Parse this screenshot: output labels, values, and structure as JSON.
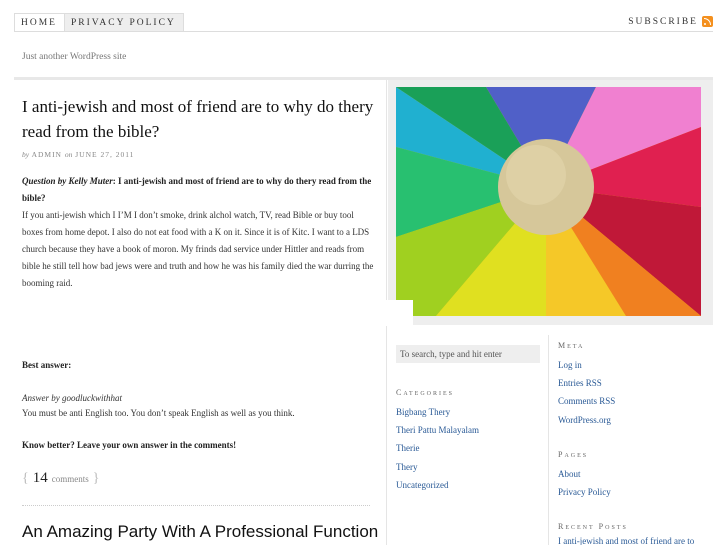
{
  "nav": {
    "tabs": [
      "HOME",
      "PRIVACY POLICY"
    ],
    "subscribe": "SUBSCRIBE"
  },
  "tagline": "Just another WordPress site",
  "post": {
    "title": "I anti-jewish and most of friend are to why do thery read from the bible?",
    "meta_by": "by",
    "meta_author": "ADMIN",
    "meta_on": "on",
    "meta_date": "JUNE 27, 2011",
    "question_by": "Question by Kelly Muter",
    "question_title": ": I anti-jewish and most of friend are to why do thery read from the bible?",
    "body": "If you anti-jewish which I I’M I don’t smoke, drink alchol watch, TV, read Bible or buy tool boxes from home depot. I also do not eat food with a K on it. Since it is of Kitc. I want to a LDS church because they have a book of moron. My frinds dad service under Hittler and reads from bible he still tell how bad jews were and truth and how he was his family died the war durring the booming raid.",
    "best_answer": "Best answer:",
    "answer_by": "Answer by goodluckwithhat",
    "answer_text": "You must be anti English too. You don’t speak English as well as you think.",
    "know_better": "Know better? Leave your own answer in the comments!",
    "comment_count": "14",
    "comments_label": "comments"
  },
  "next_post": {
    "title": "An Amazing Party With A Professional Function"
  },
  "sidebar": {
    "search_placeholder": "To search, type and hit enter",
    "categories": {
      "title": "Categories",
      "items": [
        "Bigbang Thery",
        "Theri Pattu Malayalam",
        "Therie",
        "Thery",
        "Uncategorized"
      ]
    },
    "meta": {
      "title": "Meta",
      "items": [
        "Log in",
        "Entries RSS",
        "Comments RSS",
        "WordPress.org"
      ]
    },
    "pages": {
      "title": "Pages",
      "items": [
        "About",
        "Privacy Policy"
      ]
    },
    "recent": {
      "title": "Recent Posts",
      "items": [
        "I anti-jewish and most of friend are to"
      ]
    }
  },
  "colors": {
    "link": "#2a5a96",
    "rss": "#f4901e"
  }
}
